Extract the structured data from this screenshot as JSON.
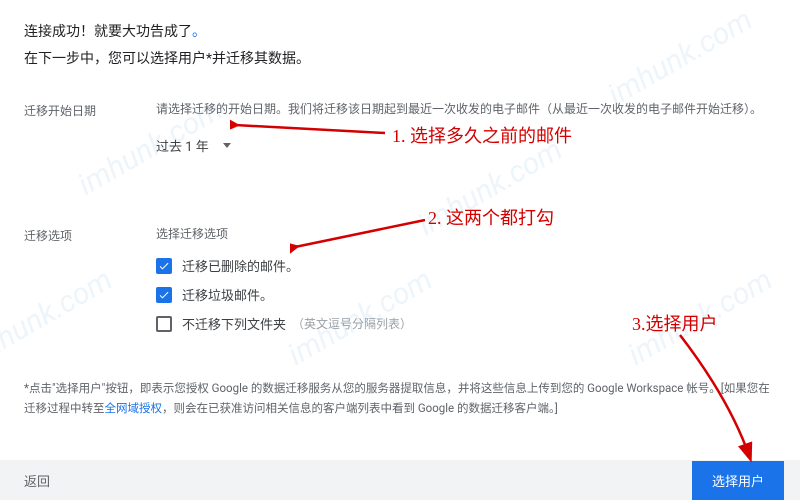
{
  "header": {
    "title_prefix": "连接成功！就要大功告成了",
    "title_dot": "。",
    "subtitle": "在下一步中，您可以选择用户*并迁移其数据。"
  },
  "date_section": {
    "label": "迁移开始日期",
    "description": "请选择迁移的开始日期。我们将迁移该日期起到最近一次收发的电子邮件（从最近一次收发的电子邮件开始迁移）。",
    "dropdown_value": "过去 1 年"
  },
  "options_section": {
    "label": "迁移选项",
    "title": "选择迁移选项",
    "items": [
      {
        "name": "opt-deleted",
        "label": "迁移已删除的邮件。",
        "checked": true
      },
      {
        "name": "opt-spam",
        "label": "迁移垃圾邮件。",
        "checked": true
      },
      {
        "name": "opt-exclude",
        "label": "不迁移下列文件夹",
        "checked": false,
        "hint": "（英文逗号分隔列表）"
      }
    ]
  },
  "footnote": {
    "pre": "*点击\"选择用户\"按钮，即表示您授权 Google 的数据迁移服务从您的服务器提取信息，并将这些信息上传到您的 Google Workspace 帐号。[如果您在迁移过程中转至",
    "link": "全网域授权",
    "post": "，则会在已获准访问相关信息的客户端列表中看到 Google 的数据迁移客户端。]"
  },
  "footer": {
    "back": "返回",
    "primary": "选择用户"
  },
  "annotations": {
    "a1": "1. 选择多久之前的邮件",
    "a2": "2. 这两个都打勾",
    "a3": "3.选择用户"
  },
  "watermark": "imhunk.com"
}
